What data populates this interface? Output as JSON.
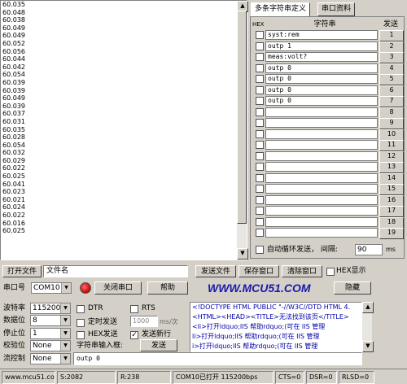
{
  "log": {
    "lines": [
      "60.035",
      "60.048",
      "60.038",
      "60.049",
      "60.049",
      "60.052",
      "60.056",
      "60.044",
      "60.042",
      "60.054",
      "60.039",
      "60.039",
      "60.049",
      "60.039",
      "60.037",
      "60.031",
      "60.035",
      "60.028",
      "60.054",
      "60.032",
      "60.029",
      "60.022",
      "60.025",
      "60.041",
      "60.023",
      "60.021",
      "60.024",
      "60.022",
      "60.016",
      "60.025"
    ]
  },
  "tabs": {
    "multi": "多条字符串定义",
    "serial": "串口资料"
  },
  "grid": {
    "hex_header": "HEX",
    "string_header": "字符串",
    "send_header": "发送",
    "rows": [
      {
        "text": "syst:rem",
        "num": "1"
      },
      {
        "text": "outp 1",
        "num": "2"
      },
      {
        "text": "meas:volt?",
        "num": "3"
      },
      {
        "text": "outp 0",
        "num": "4"
      },
      {
        "text": "outp 0",
        "num": "5"
      },
      {
        "text": "outp 0",
        "num": "6"
      },
      {
        "text": "outp 0",
        "num": "7"
      },
      {
        "text": "",
        "num": "8"
      },
      {
        "text": "",
        "num": "9"
      },
      {
        "text": "",
        "num": "10"
      },
      {
        "text": "",
        "num": "11"
      },
      {
        "text": "",
        "num": "12"
      },
      {
        "text": "",
        "num": "13"
      },
      {
        "text": "",
        "num": "14"
      },
      {
        "text": "",
        "num": "15"
      },
      {
        "text": "",
        "num": "16"
      },
      {
        "text": "",
        "num": "17"
      },
      {
        "text": "",
        "num": "18"
      },
      {
        "text": "",
        "num": "19"
      }
    ],
    "auto_cycle_label": "自动循环发送，  间隔:",
    "interval": "90",
    "interval_unit": "ms"
  },
  "file_row": {
    "open_file": "打开文件",
    "file_name": "文件名",
    "send_file": "发送文件",
    "save_window": "保存窗口",
    "clear_window": "清除窗口",
    "hex_display": "HEX显示"
  },
  "port_row": {
    "port_label": "串口号",
    "port_value": "COM10",
    "close_port": "关闭串口",
    "help": "帮助",
    "logo": "WWW.MCU51.COM",
    "hide": "隐藏"
  },
  "settings": {
    "baud_label": "波特率",
    "baud_value": "115200",
    "data_label": "数据位",
    "data_value": "8",
    "stop_label": "停止位",
    "stop_value": "1",
    "parity_label": "校验位",
    "parity_value": "None",
    "flow_label": "流控制",
    "flow_value": "None"
  },
  "options": {
    "dtr": "DTR",
    "rts": "RTS",
    "timed_send": "定时发送",
    "period_value": "1000",
    "period_unit": "ms/次",
    "hex_send": "HEX发送",
    "send_newline": "发送新行",
    "input_label": "字符串输入框:",
    "send_button": "发送",
    "input_value": "outp 0"
  },
  "html_preview": {
    "lines": [
      "<!DOCTYPE HTML PUBLIC \"-//W3C//DTD HTML 4.",
      "<HTML><HEAD><TITLE>无法找到该页</TITLE>",
      "<li>打开ldquo;IIS 帮助rdquo;(可在 IIS 管理",
      "li>打开ldquo;IIS 帮助rdquo;(可在 IIS 管理",
      "i>打开ldquo;IIS 帮助rdquo;(可在 IIS 管理"
    ]
  },
  "status": {
    "site": "www.mcu51.com",
    "sent": "S:2082",
    "received": "R:238",
    "port_status": "COM10已打开  115200bps",
    "cts": "CTS=0",
    "dsr": "DSR=0",
    "rlsd": "RLSD=0"
  },
  "colors": {
    "logo": "#1a1aa8",
    "led": "#cc1111",
    "selected_tab": "#ffffff"
  }
}
